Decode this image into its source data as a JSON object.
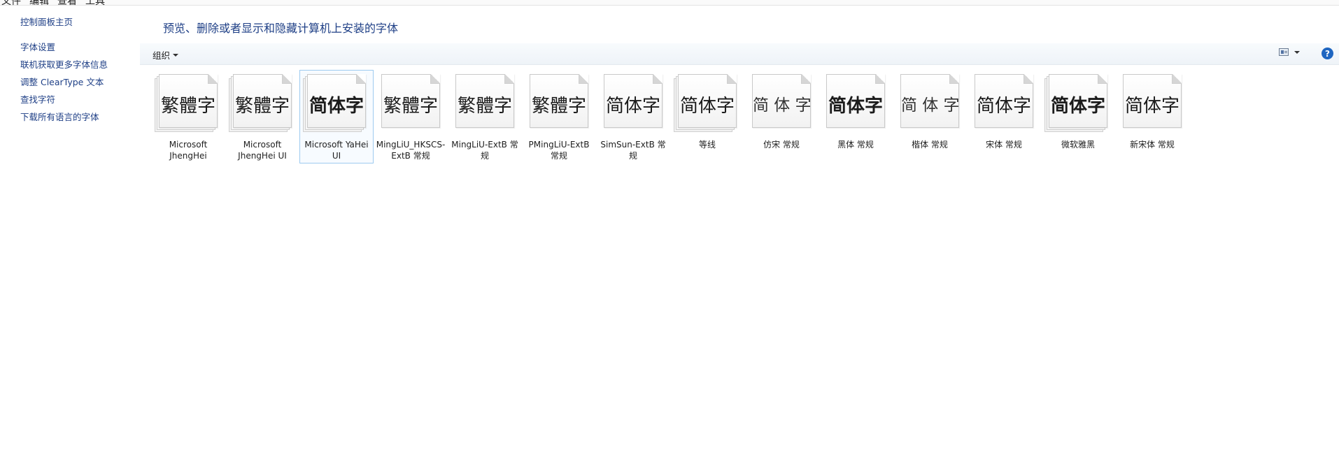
{
  "top_strip_cut": [
    "文件",
    "编辑",
    "查看",
    "工具"
  ],
  "sidebar": {
    "items": [
      {
        "label": "控制面板主页"
      },
      {
        "label": "字体设置"
      },
      {
        "label": "联机获取更多字体信息"
      },
      {
        "label": "调整 ClearType 文本"
      },
      {
        "label": "查找字符"
      },
      {
        "label": "下载所有语言的字体"
      }
    ]
  },
  "header": {
    "title": "预览、删除或者显示和隐藏计算机上安装的字体"
  },
  "toolbar": {
    "organize_label": "组织",
    "help_label": "?"
  },
  "fonts": [
    {
      "sample": "繁體字",
      "name": "Microsoft JhengHei"
    },
    {
      "sample": "繁體字",
      "name": "Microsoft JhengHei UI"
    },
    {
      "sample": "简体字",
      "name": "Microsoft YaHei UI"
    },
    {
      "sample": "繁體字",
      "name": "MingLiU_HKSCS-ExtB 常规"
    },
    {
      "sample": "繁體字",
      "name": "MingLiU-ExtB 常规"
    },
    {
      "sample": "繁體字",
      "name": "PMingLiU-ExtB 常规"
    },
    {
      "sample": "简体字",
      "name": "SimSun-ExtB 常规"
    },
    {
      "sample": "简体字",
      "name": "等线"
    },
    {
      "sample": "简 体 字",
      "name": "仿宋 常规"
    },
    {
      "sample": "简体字",
      "name": "黑体 常规"
    },
    {
      "sample": "简 体 字",
      "name": "楷体 常规"
    },
    {
      "sample": "简体字",
      "name": "宋体 常规"
    },
    {
      "sample": "简体字",
      "name": "微软雅黑"
    },
    {
      "sample": "简体字",
      "name": "新宋体 常规"
    }
  ]
}
